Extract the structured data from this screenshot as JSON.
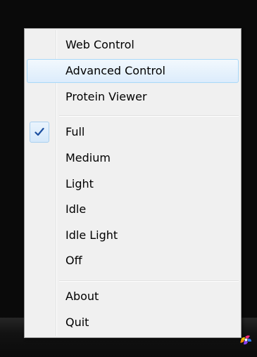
{
  "menu": {
    "items": [
      {
        "label": "Web Control"
      },
      {
        "label": "Advanced Control"
      },
      {
        "label": "Protein Viewer"
      },
      {
        "label": "Full"
      },
      {
        "label": "Medium"
      },
      {
        "label": "Light"
      },
      {
        "label": "Idle"
      },
      {
        "label": "Idle Light"
      },
      {
        "label": "Off"
      },
      {
        "label": "About"
      },
      {
        "label": "Quit"
      }
    ],
    "highlighted_item": "Advanced Control",
    "checked_item": "Full",
    "check_icon": "checkmark-icon"
  },
  "tray": {
    "icon": "folding-at-home-icon"
  },
  "colors": {
    "menu_background": "#f0f0f0",
    "highlight_border": "#a8d8f8",
    "check_color": "#1c4fa0",
    "taskbar": "#121212"
  }
}
